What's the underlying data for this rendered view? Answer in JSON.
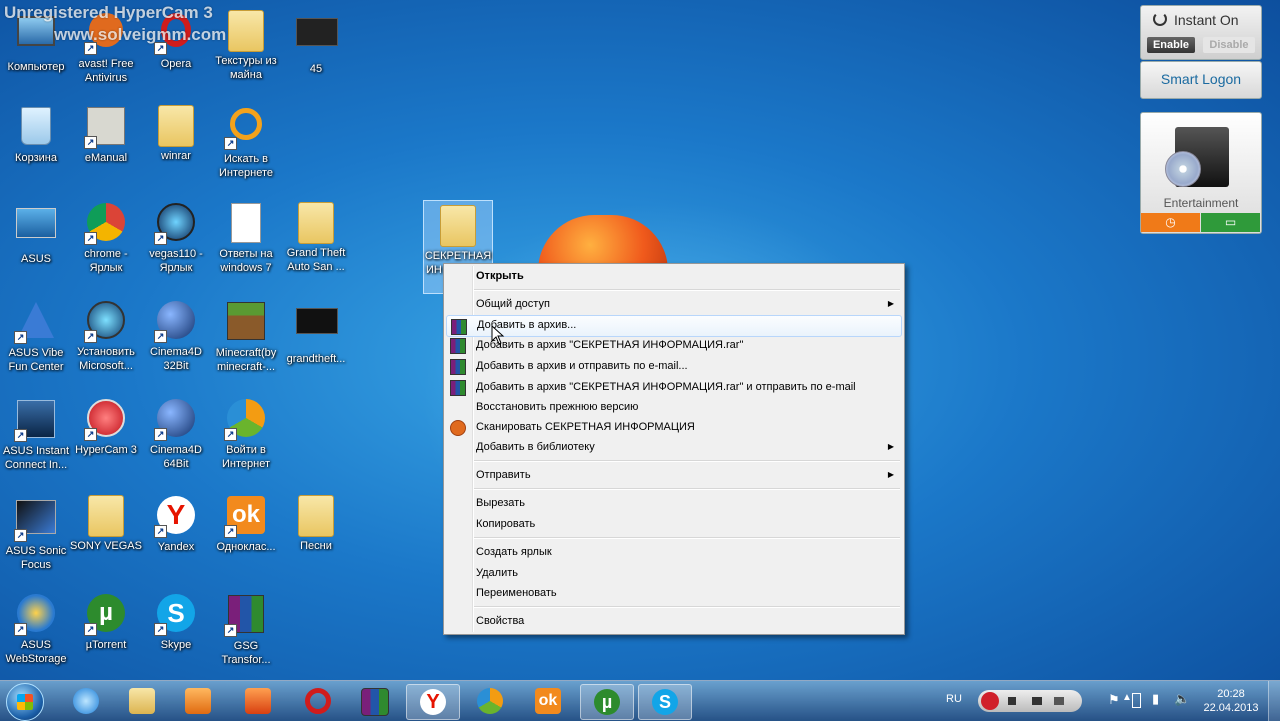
{
  "watermark": {
    "line1": "Unregistered HyperCam 3",
    "line2": "www.solveigmm.com"
  },
  "desktop_icons": [
    {
      "label": "Компьютер",
      "icon": "computer-icon"
    },
    {
      "label": "avast! Free Antivirus",
      "icon": "avast-icon"
    },
    {
      "label": "Opera",
      "icon": "opera-icon"
    },
    {
      "label": "Текстуры из майна",
      "icon": "folder-icon"
    },
    {
      "label": "45",
      "icon": "video-file-icon"
    },
    {
      "label": "Корзина",
      "icon": "recycle-bin-icon"
    },
    {
      "label": "eManual",
      "icon": "emanual-icon"
    },
    {
      "label": "winrar",
      "icon": "folder-icon"
    },
    {
      "label": "Искать в Интернете",
      "icon": "search-web-icon"
    },
    {
      "label": "ASUS",
      "icon": "asus-icon"
    },
    {
      "label": "chrome - Ярлык",
      "icon": "chrome-icon"
    },
    {
      "label": "vegas110 - Ярлык",
      "icon": "vegas-icon"
    },
    {
      "label": "Ответы на windows 7",
      "icon": "document-icon"
    },
    {
      "label": "Grand Theft Auto San ...",
      "icon": "folder-icon"
    },
    {
      "label": "ASUS Vibe Fun Center",
      "icon": "asus-vibe-icon"
    },
    {
      "label": "Установить Microsoft...",
      "icon": "install-icon"
    },
    {
      "label": "Cinema4D 32Bit",
      "icon": "cinema4d-icon"
    },
    {
      "label": "Minecraft(by minecraft-...",
      "icon": "minecraft-icon"
    },
    {
      "label": "grandtheft...",
      "icon": "video-file-icon"
    },
    {
      "label": "ASUS Instant Connect In...",
      "icon": "asus-connect-icon"
    },
    {
      "label": "HyperCam 3",
      "icon": "hypercam-icon"
    },
    {
      "label": "Cinema4D 64Bit",
      "icon": "cinema4d-icon"
    },
    {
      "label": "Войти в Интернет",
      "icon": "internet-icon"
    },
    {
      "label": "ASUS Sonic Focus",
      "icon": "asus-sonic-icon"
    },
    {
      "label": "SONY VEGAS",
      "icon": "folder-icon"
    },
    {
      "label": "Yandex",
      "icon": "yandex-icon"
    },
    {
      "label": "Одноклас...",
      "icon": "odnoklassniki-icon"
    },
    {
      "label": "Песни",
      "icon": "folder-icon"
    },
    {
      "label": "ASUS WebStorage",
      "icon": "asus-webstorage-icon"
    },
    {
      "label": "µTorrent",
      "icon": "utorrent-icon"
    },
    {
      "label": "Skype",
      "icon": "skype-icon"
    },
    {
      "label": "GSG Transfor...",
      "icon": "winrar-icon"
    }
  ],
  "selected_icon": {
    "label_line1": "СЕКРЕТНАЯ",
    "label_line2": "ИН"
  },
  "context_menu": {
    "open": "Открыть",
    "share": "Общий доступ",
    "add_archive": "Добавить в архив...",
    "add_archive_named": "Добавить в архив \"СЕКРЕТНАЯ ИНФОРМАЦИЯ.rar\"",
    "add_archive_email": "Добавить в архив и отправить по e-mail...",
    "add_archive_named_email": "Добавить в архив \"СЕКРЕТНАЯ ИНФОРМАЦИЯ.rar\" и отправить по e-mail",
    "restore": "Восстановить прежнюю версию",
    "scan": "Сканировать СЕКРЕТНАЯ ИНФОРМАЦИЯ",
    "add_library": "Добавить в библиотеку",
    "send_to": "Отправить",
    "cut": "Вырезать",
    "copy": "Копировать",
    "create_shortcut": "Создать ярлык",
    "delete": "Удалить",
    "rename": "Переименовать",
    "properties": "Свойства"
  },
  "gadgets": {
    "instant_on": "Instant On",
    "enable": "Enable",
    "disable": "Disable",
    "smart_logon": "Smart Logon",
    "entertainment": "Entertainment"
  },
  "taskbar": {
    "language": "RU",
    "time": "20:28",
    "date": "22.04.2013"
  }
}
